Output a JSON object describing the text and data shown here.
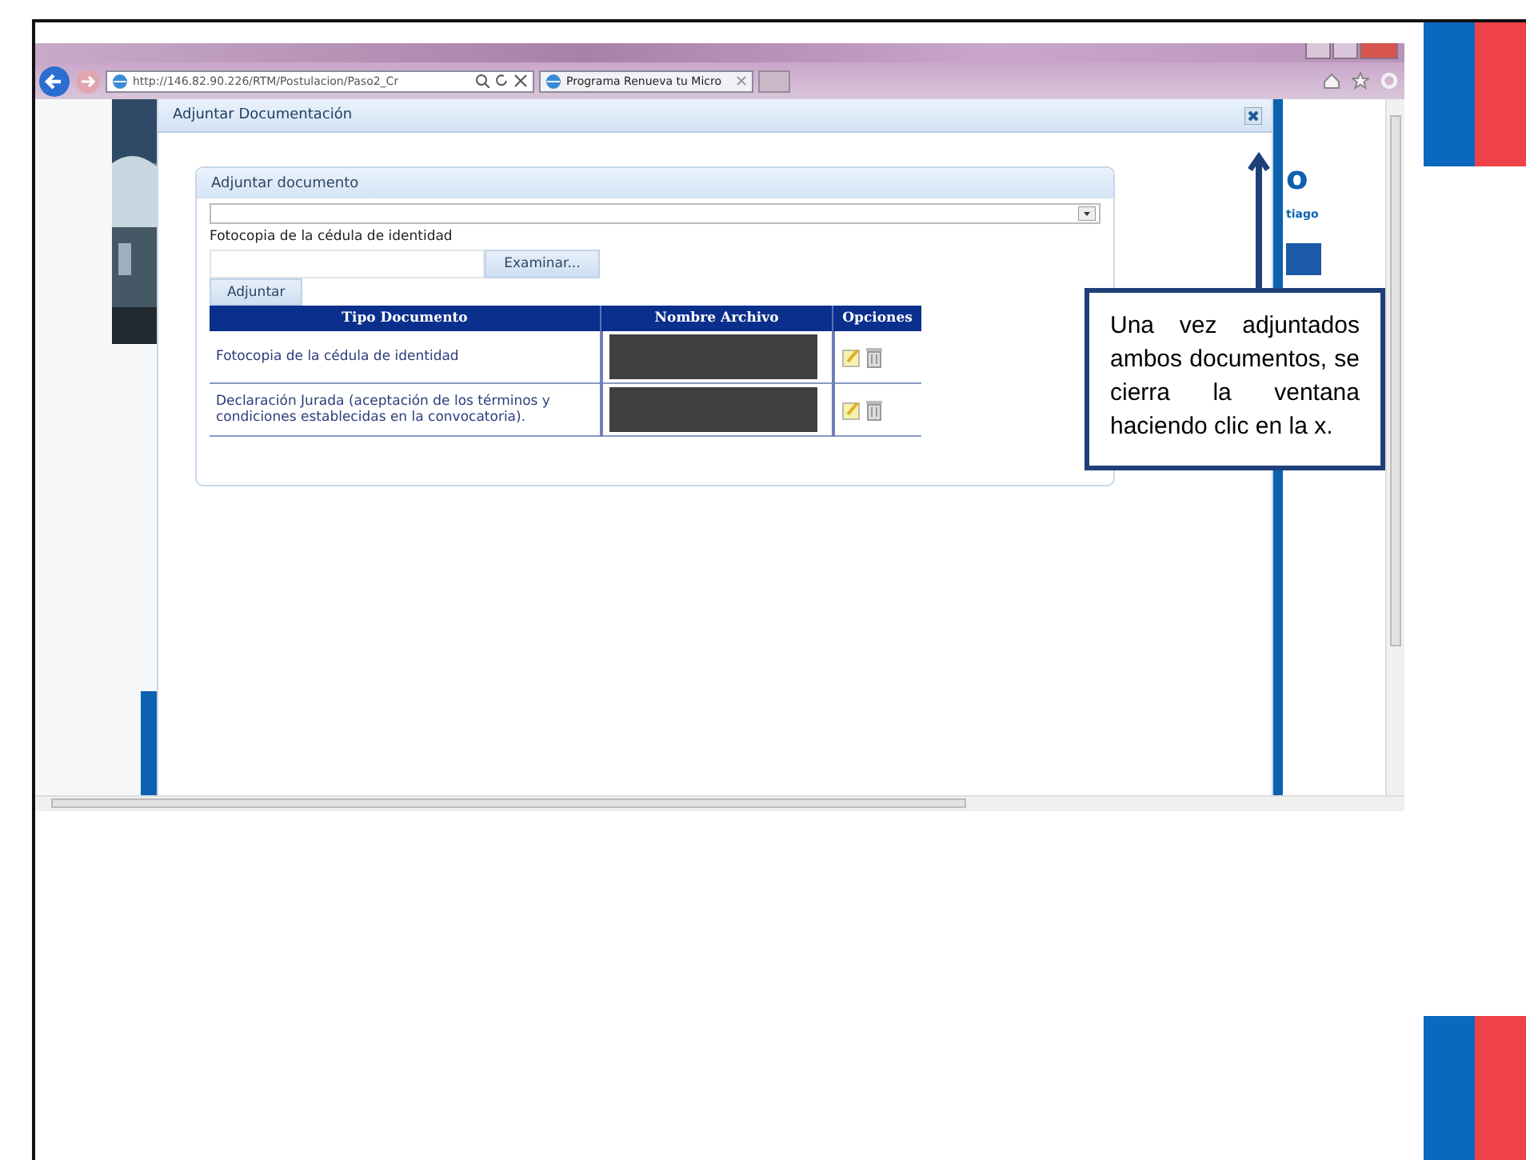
{
  "browser": {
    "address": "http://146.82.90.226/RTM/Postulacion/Paso2_Cr",
    "tab_title": "Programa Renueva tu Micro"
  },
  "background_page": {
    "fragments": [
      "o",
      "tiago"
    ]
  },
  "dialog": {
    "title": "Adjuntar Documentación",
    "panel": {
      "title": "Adjuntar documento",
      "field_label": "Fotocopia de la cédula de identidad",
      "browse_button": "Examinar...",
      "attach_button": "Adjuntar",
      "table": {
        "columns": [
          "Tipo Documento",
          "Nombre Archivo",
          "Opciones"
        ],
        "rows": [
          {
            "type": "Fotocopia de la cédula de identidad",
            "file_redacted": true
          },
          {
            "type": "Declaración Jurada (aceptación de los términos y condiciones establecidas en la convocatoria).",
            "file_redacted": true
          }
        ]
      }
    }
  },
  "callout": {
    "text": "Una vez adjuntados ambos documentos, se cierra la ventana haciendo clic en la x."
  }
}
